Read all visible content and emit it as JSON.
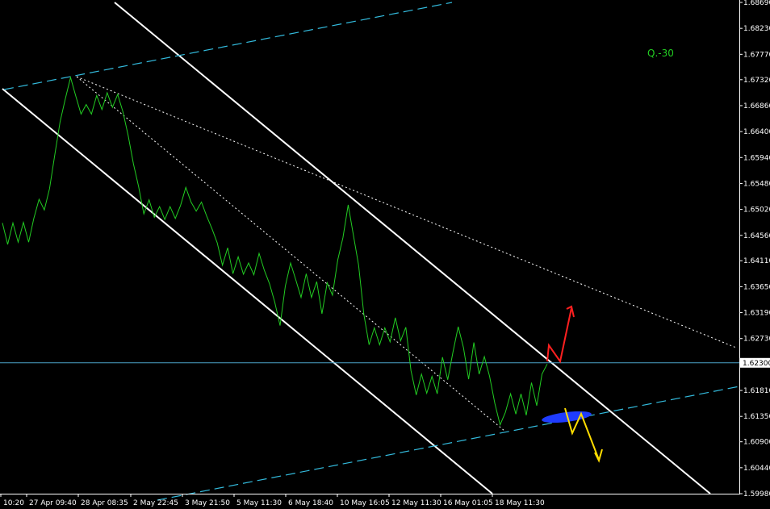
{
  "chart_data": {
    "type": "line",
    "title": "",
    "xlabel": "",
    "ylabel": "",
    "ylim": [
      1.5998,
      1.6869
    ],
    "grid": false,
    "y_ticks": [
      1.6869,
      1.6823,
      1.6777,
      1.6732,
      1.6686,
      1.664,
      1.6594,
      1.6548,
      1.6502,
      1.6456,
      1.6411,
      1.6365,
      1.6319,
      1.6273,
      1.623,
      1.6181,
      1.6135,
      1.609,
      1.6044,
      1.5998
    ],
    "y_tick_labels": [
      "1.68690",
      "1.68230",
      "1.67770",
      "1.67320",
      "1.66860",
      "1.66400",
      "1.65940",
      "1.65480",
      "1.65020",
      "1.64560",
      "1.64110",
      "1.63650",
      "1.63190",
      "1.62730",
      "1.62300",
      "1.61810",
      "1.61350",
      "1.60900",
      "1.60440",
      "1.59980"
    ],
    "x_tick_labels": [
      "10:20",
      "27 Apr 09:40",
      "28 Apr 08:35",
      "2 May 22:45",
      "3 May 21:50",
      "5 May 11:30",
      "6 May 18:40",
      "10 May 16:05",
      "12 May 11:30",
      "16 May 01:05",
      "18 May 11:30"
    ],
    "current_price": 1.623,
    "current_price_label": "1.62300",
    "annotation": "Q.-30",
    "colors": {
      "background": "#000000",
      "price_line": "#22cc22",
      "channel": "#ffffff",
      "support_dashed": "#33bbdd",
      "trend_dotted": "#ffffff",
      "current_price_line": "#4aa3c8",
      "up_arrow": "#ff2020",
      "down_arrow": "#ffdd00",
      "zone": "#1f3cff",
      "annotation": "#22cc22"
    },
    "series": [
      {
        "values": [
          1.6478,
          1.644,
          1.6478,
          1.6444,
          1.6479,
          1.6444,
          1.6486,
          1.652,
          1.6501,
          1.6539,
          1.6599,
          1.6657,
          1.6698,
          1.6736,
          1.6703,
          1.6671,
          1.6688,
          1.6671,
          1.6704,
          1.6679,
          1.6709,
          1.6683,
          1.6706,
          1.6675,
          1.6633,
          1.6583,
          1.6542,
          1.6494,
          1.6519,
          1.6488,
          1.6507,
          1.6484,
          1.6507,
          1.6486,
          1.6509,
          1.6541,
          1.6515,
          1.6499,
          1.6515,
          1.649,
          1.6468,
          1.6443,
          1.6403,
          1.6434,
          1.6388,
          1.6418,
          1.6387,
          1.6407,
          1.6386,
          1.6424,
          1.6394,
          1.637,
          1.6337,
          1.6296,
          1.6366,
          1.6407,
          1.6377,
          1.6346,
          1.6388,
          1.6346,
          1.6374,
          1.6317,
          1.6372,
          1.635,
          1.6412,
          1.6452,
          1.651,
          1.6456,
          1.6403,
          1.6316,
          1.6262,
          1.6292,
          1.6262,
          1.6292,
          1.6267,
          1.631,
          1.6269,
          1.6293,
          1.6216,
          1.6173,
          1.621,
          1.6176,
          1.6206,
          1.6175,
          1.624,
          1.62,
          1.6249,
          1.6294,
          1.6257,
          1.6201,
          1.6266,
          1.621,
          1.6241,
          1.6206,
          1.6158,
          1.612,
          1.6142,
          1.6175,
          1.6139,
          1.6175,
          1.6137,
          1.6195,
          1.6154,
          1.621,
          1.6228
        ]
      }
    ],
    "signals": [
      "up-arrow",
      "down-arrow",
      "blue-zone"
    ]
  }
}
